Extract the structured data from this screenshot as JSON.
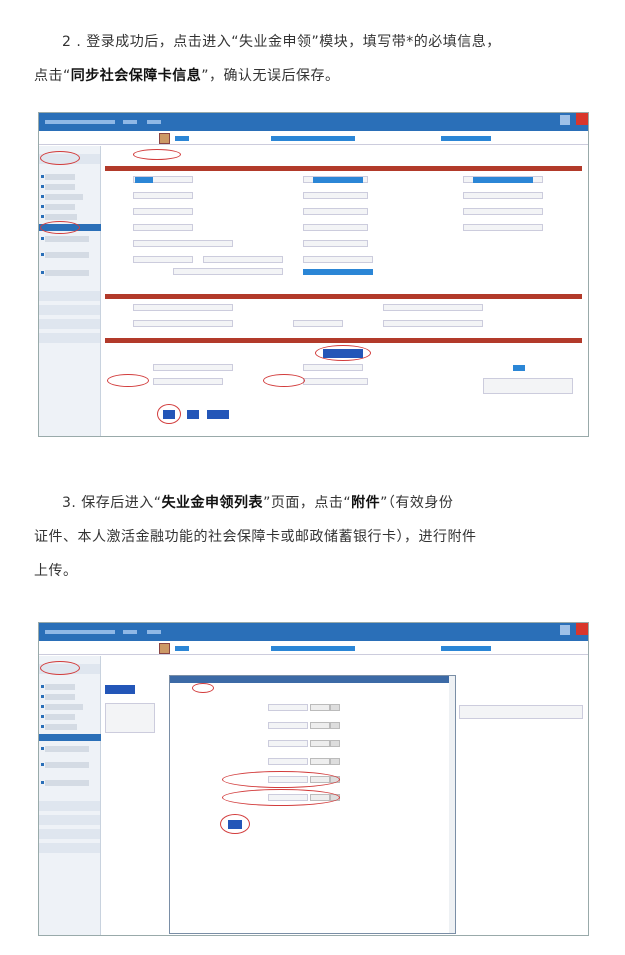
{
  "step2": {
    "line1": "2 . 登录成功后，点击进入“失业金申领”模块，填写带*的必填信息，",
    "line2_prefix": "点击“",
    "line2_bold": "同步社会保障卡信息",
    "line2_suffix": "”，确认无误后保存。"
  },
  "step3": {
    "line1_prefix": "3. 保存后进入“",
    "line1_bold1": "失业金申领列表",
    "line1_mid": "”页面，点击“",
    "line1_bold2": "附件",
    "line1_suffix": "”（有效身份",
    "line2": "证件、本人激活金融功能的社会保障卡或邮政储蓄银行卡），进行附件",
    "line3": "上传。"
  },
  "colors": {
    "titlebar": "#2a6fb8",
    "section_bar": "#b23a2a",
    "highlight": "#d23c3c",
    "button": "#2356b8"
  }
}
